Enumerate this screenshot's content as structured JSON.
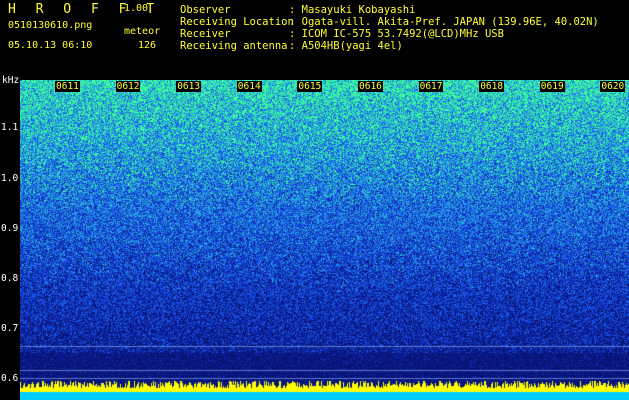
{
  "header": {
    "title": "H R O F F T",
    "version": "1.00",
    "filename": "0510130610.png",
    "meteor_label": "meteor",
    "datetime": "05.10.13 06:10",
    "meteor_count": "126",
    "rows": [
      {
        "label": "Observer",
        "value": ": Masayuki Kobayashi"
      },
      {
        "label": "Receiving Location",
        "value": ": Ogata-vill. Akita-Pref. JAPAN (139.96E, 40.02N)"
      },
      {
        "label": "Receiver",
        "value": ": ICOM IC-575 53.7492(@LCD)MHz USB"
      },
      {
        "label": "Receiving antenna",
        "value": ": A504HB(yagi 4el)"
      }
    ]
  },
  "spectrogram": {
    "freq_unit": "kHz",
    "freq_ticks": [
      "1.1",
      "1.0",
      "0.9",
      "0.8",
      "0.7",
      "0.6"
    ],
    "time_ticks": [
      "0611",
      "0612",
      "0613",
      "0614",
      "0615",
      "0616",
      "0617",
      "0618",
      "0619",
      "0620"
    ],
    "colors": {
      "low": "#0a1a8a",
      "mid": "#1a4fe0",
      "high": "#33ff99",
      "bar": "#ffff00",
      "base": "#00ccff"
    }
  }
}
